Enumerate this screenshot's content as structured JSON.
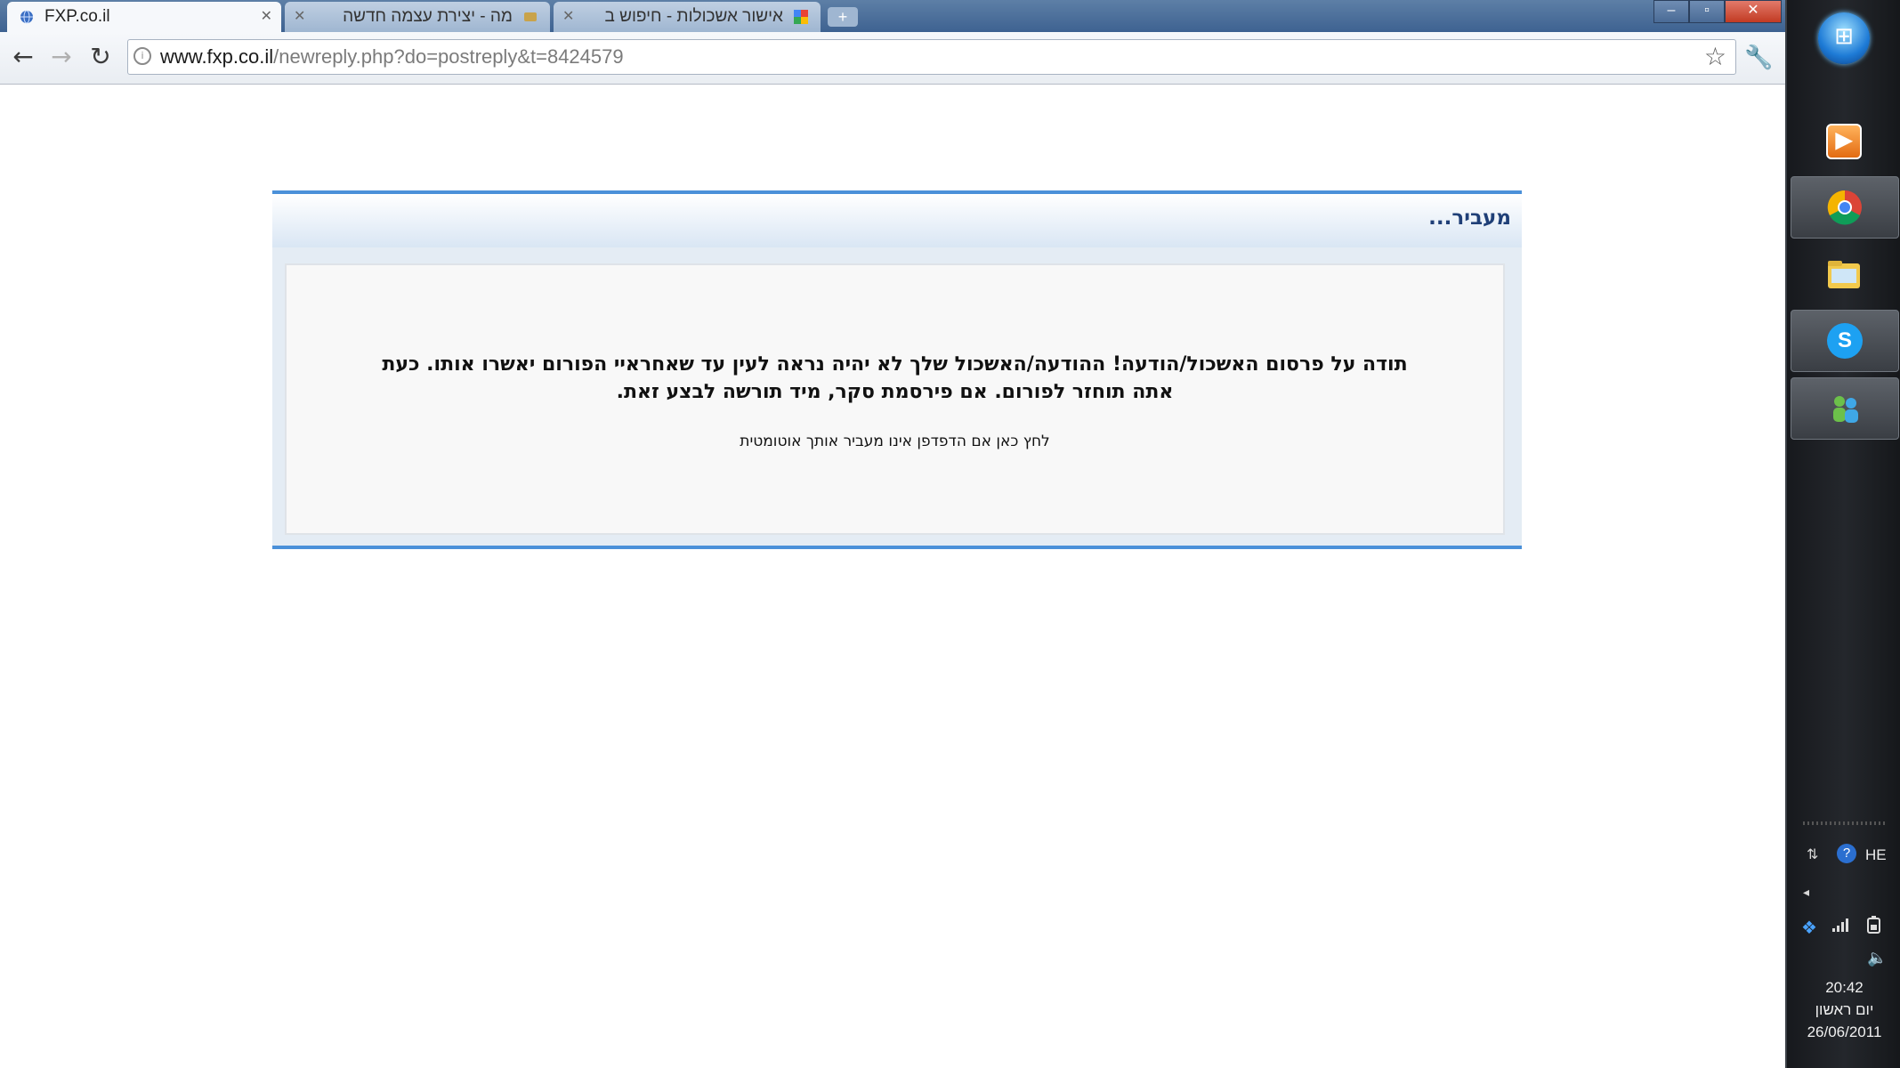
{
  "browser": {
    "tabs": [
      {
        "title": "FXP.co.il",
        "active": true
      },
      {
        "title": "מה - יצירת עצמה חדשה",
        "active": false
      },
      {
        "title": "אישור אשכולות - חיפוש ב",
        "active": false
      }
    ],
    "new_tab_label": "+",
    "window_controls": {
      "minimize": "–",
      "maximize": "▫",
      "close": "✕"
    },
    "nav": {
      "back": "←",
      "forward": "→",
      "reload": "↻"
    },
    "address": {
      "host": "www.fxp.co.il",
      "path": "/newreply.php?do=postreply&t=8424579"
    },
    "bookmark_star": "☆",
    "wrench": "🔧"
  },
  "page": {
    "box_title": "מעביר...",
    "message": "תודה על פרסום האשכול/הודעה! ההודעה/האשכול שלך לא יהיה נראה לעין עד שאחראיי הפורום יאשרו אותו. כעת אתה תוחזר לפורום. אם פירסמת סקר, מיד תורשה לבצע זאת.",
    "redirect_link": "לחץ כאן אם הדפדפן אינו מעביר אותך אוטומטית"
  },
  "taskbar": {
    "items": [
      {
        "name": "media-player",
        "selected": false
      },
      {
        "name": "chrome",
        "selected": true
      },
      {
        "name": "explorer",
        "selected": false
      },
      {
        "name": "skype",
        "selected": true
      },
      {
        "name": "messenger",
        "selected": true
      }
    ],
    "tray": {
      "language": "HE",
      "help": "?",
      "arrow": "◂"
    },
    "clock": {
      "time": "20:42",
      "day": "יום ראשון",
      "date": "26/06/2011"
    }
  },
  "colors": {
    "accent_blue": "#4a90d9",
    "title_blue": "#1f3f77",
    "taskbar_dark": "#1c1e22"
  }
}
